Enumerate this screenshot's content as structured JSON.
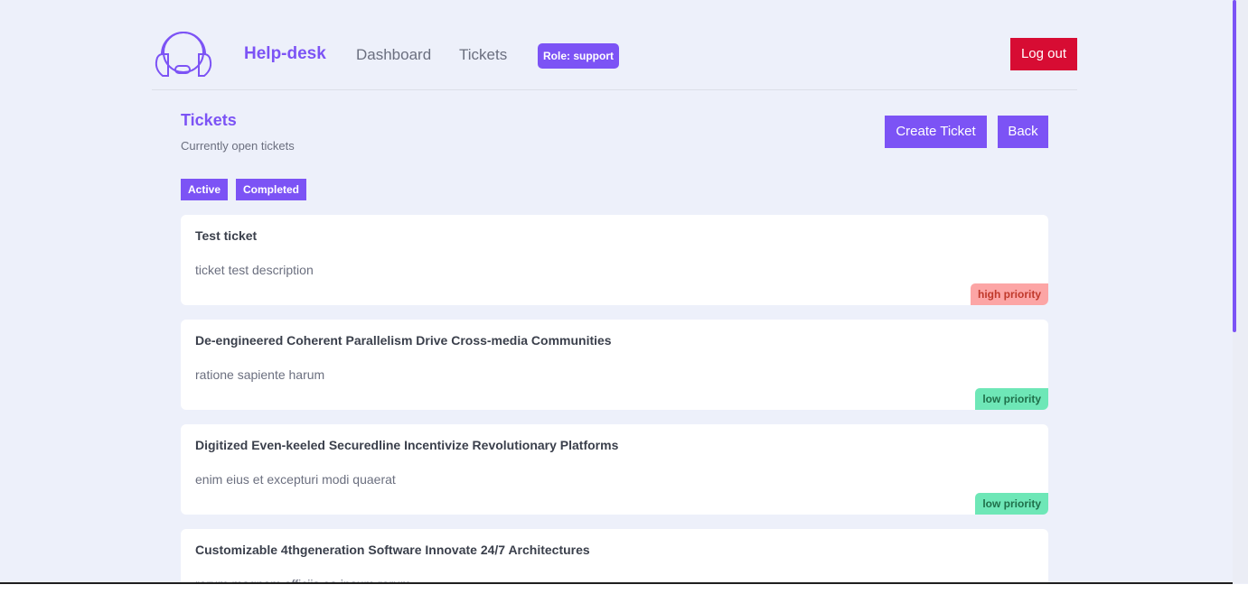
{
  "header": {
    "brand": "Help-desk",
    "nav": {
      "dashboard": "Dashboard",
      "tickets": "Tickets"
    },
    "role_badge": "Role: support",
    "logout_label": "Log out",
    "logo_icon": "headset-icon"
  },
  "page": {
    "title": "Tickets",
    "subtitle": "Currently open tickets",
    "create_label": "Create Ticket",
    "back_label": "Back"
  },
  "filters": {
    "active": "Active",
    "completed": "Completed"
  },
  "tickets": [
    {
      "title": "Test ticket",
      "description": "ticket test description",
      "priority": "high priority"
    },
    {
      "title": "De-engineered Coherent Parallelism Drive Cross-media Communities",
      "description": "ratione sapiente harum",
      "priority": "low priority"
    },
    {
      "title": "Digitized Even-keeled Securedline Incentivize Revolutionary Platforms",
      "description": "enim eius et excepturi modi quaerat",
      "priority": "low priority"
    },
    {
      "title": "Customizable 4thgeneration Software Innovate 24/7 Architectures",
      "description": "rerum magnam officiis ea ipsum rerum",
      "priority": ""
    }
  ],
  "colors": {
    "accent": "#7c53f5",
    "danger": "#d70c33",
    "high_priority_bg": "#fca5a5",
    "low_priority_bg": "#6ee7b7",
    "page_bg": "#edf0fa"
  }
}
